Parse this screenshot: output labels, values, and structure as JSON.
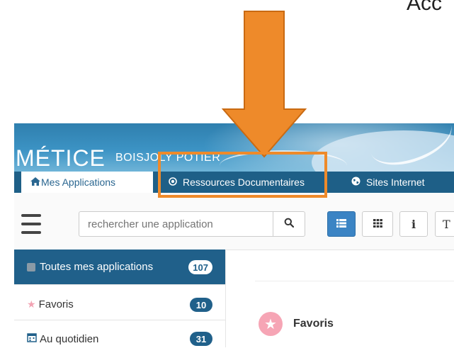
{
  "top_partial_text": "Acc",
  "header": {
    "brand": "MÉTICE",
    "school": "BOISJOLY POTIER"
  },
  "nav": {
    "tabs": [
      {
        "label": "Mes Applications",
        "icon": "home-icon",
        "active": true
      },
      {
        "label": "Ressources Documentaires",
        "icon": "dot-circle-icon",
        "active": false
      },
      {
        "label": "Sites Internet",
        "icon": "globe-icon",
        "active": false
      }
    ]
  },
  "toolbar": {
    "search_placeholder": "rechercher une application",
    "view_buttons": [
      "list-view",
      "grid-view",
      "info",
      "text"
    ],
    "partial_button_label": "T"
  },
  "sidebar": {
    "items": [
      {
        "label": "Toutes mes applications",
        "count": "107",
        "icon": "square-icon",
        "active": true
      },
      {
        "label": "Favoris",
        "count": "10",
        "icon": "star-icon",
        "active": false
      },
      {
        "label": "Au quotidien",
        "count": "31",
        "icon": "calendar-icon",
        "active": false
      }
    ]
  },
  "main": {
    "section_title": "Favoris"
  },
  "colors": {
    "banner": "#3c93c4",
    "nav": "#1e5f87",
    "accent": "#20608a",
    "highlight": "#ee8a2a",
    "fav": "#f6a5b5"
  }
}
